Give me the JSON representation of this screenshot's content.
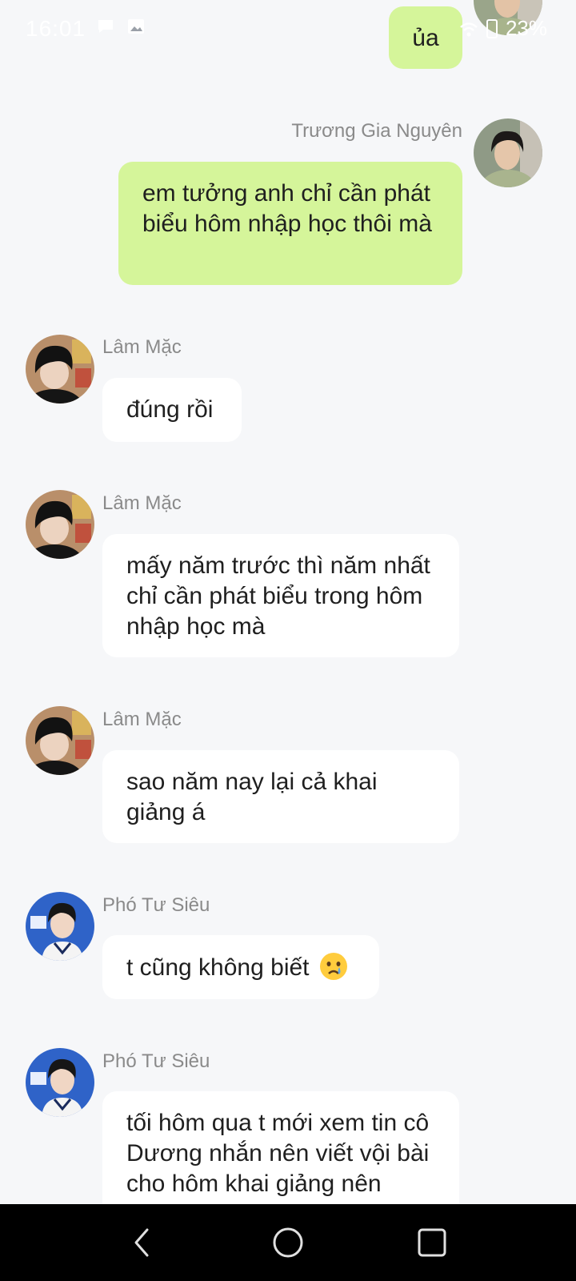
{
  "status_bar": {
    "time": "16:01",
    "battery_percent": "23%",
    "left_icons": [
      "message-notification-icon",
      "image-notification-icon"
    ],
    "right_icons": [
      "wifi-icon",
      "battery-icon"
    ]
  },
  "messages": [
    {
      "direction": "outgoing",
      "sender": "",
      "text": "ủa"
    },
    {
      "direction": "outgoing",
      "sender": "Trương Gia Nguyên",
      "text": "em tưởng anh chỉ cần phát biểu hôm nhập học thôi mà"
    },
    {
      "direction": "incoming",
      "sender": "Lâm Mặc",
      "text": "đúng rồi"
    },
    {
      "direction": "incoming",
      "sender": "Lâm Mặc",
      "text": "mấy năm trước thì năm nhất chỉ cần phát biểu trong hôm nhập học mà"
    },
    {
      "direction": "incoming",
      "sender": "Lâm Mặc",
      "text": "sao năm nay lại cả khai giảng á"
    },
    {
      "direction": "incoming",
      "sender": "Phó Tư Siêu",
      "text": "t cũng không biết",
      "emoji": "crying-face-emoji"
    },
    {
      "direction": "incoming",
      "sender": "Phó Tư Siêu",
      "text": "tối hôm qua t mới xem tin cô Dương nhắn nên viết vội bài cho hôm khai giảng nên"
    }
  ],
  "colors": {
    "background": "#f6f7f9",
    "outgoing_bubble": "#d5f59a",
    "incoming_bubble": "#ffffff",
    "sender_name": "#8a8a8a"
  },
  "nav_bar": {
    "buttons": [
      "back-button",
      "home-button",
      "recents-button"
    ]
  }
}
